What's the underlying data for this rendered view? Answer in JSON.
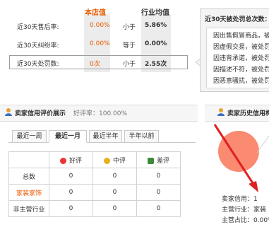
{
  "top_stats": {
    "header_store": "本店值",
    "header_industry": "行业均值",
    "rows": [
      {
        "label": "近30天售后率:",
        "store": "0.00%",
        "compare": "小于",
        "industry": "5.86%"
      },
      {
        "label": "近30天纠纷率:",
        "store": "0.00%",
        "compare": "等于",
        "industry": "0.00%"
      },
      {
        "label": "近30天处罚数:",
        "store": "0次",
        "compare": "小于",
        "industry": "2.55次"
      }
    ]
  },
  "penalty_popup": {
    "title": "近30天被处罚总次数：",
    "lines": [
      "因出售假冒商品，被处",
      "因虚假交易，被处罚",
      "因违背承诺，被处罚",
      "因描述不符，被处罚",
      "因恶意骚扰，被处罚"
    ]
  },
  "rating_section": {
    "title": "卖家信用评价展示",
    "rate_label": "好评率：100.00%",
    "tabs": [
      "最近一周",
      "最近一月",
      "最近半年",
      "半年以前"
    ],
    "active_tab": 1,
    "columns": [
      "好评",
      "中评",
      "差评"
    ],
    "rows": [
      {
        "label": "总数",
        "values": [
          "0",
          "0",
          "0"
        ]
      },
      {
        "label": "家装家饰",
        "values": [
          "0",
          "0",
          "0"
        ]
      },
      {
        "label": "非主营行业",
        "values": [
          "0",
          "0",
          "0"
        ]
      }
    ]
  },
  "history_section": {
    "title": "卖家历史信用构",
    "lines": [
      "卖家信用：1",
      "主营行业：家装",
      "主营占比：0.00%"
    ]
  },
  "colors": {
    "accent_orange": "#e85a00",
    "pie_color": "#fa8a70",
    "arrow_red": "#e02020"
  }
}
